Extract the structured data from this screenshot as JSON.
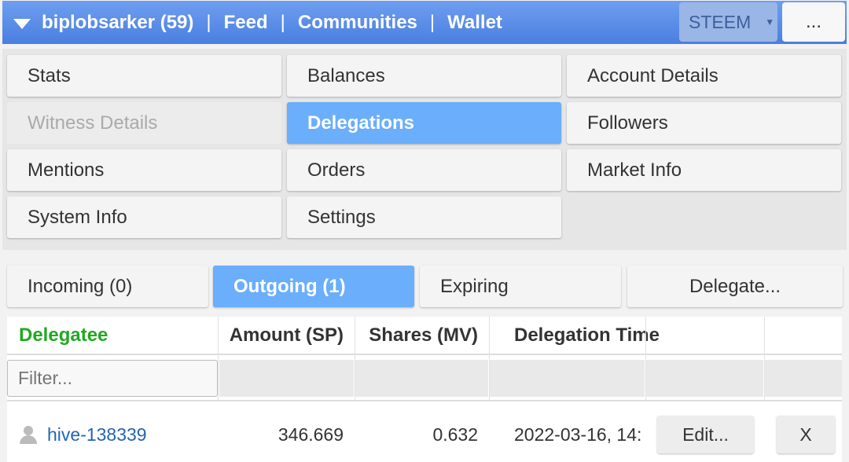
{
  "topbar": {
    "account": "biplobsarker (59)",
    "links": [
      "Feed",
      "Communities",
      "Wallet"
    ],
    "chain": "STEEM",
    "more": "..."
  },
  "menu": {
    "items": [
      {
        "label": "Stats"
      },
      {
        "label": "Balances"
      },
      {
        "label": "Account Details"
      },
      {
        "label": "Witness Details"
      },
      {
        "label": "Delegations"
      },
      {
        "label": "Followers"
      },
      {
        "label": "Mentions"
      },
      {
        "label": "Orders"
      },
      {
        "label": "Market Info"
      },
      {
        "label": "System Info"
      },
      {
        "label": "Settings"
      }
    ]
  },
  "tabs": {
    "incoming": "Incoming (0)",
    "outgoing": "Outgoing (1)",
    "expiring": "Expiring",
    "delegate": "Delegate..."
  },
  "table": {
    "headers": [
      "Delegatee",
      "Amount (SP)",
      "Shares (MV)",
      "Delegation Time"
    ],
    "filter_placeholder": "Filter...",
    "rows": [
      {
        "delegatee": "hive-138339",
        "amount": "346.669",
        "shares": "0.632",
        "time": "2022-03-16, 14:",
        "edit": "Edit...",
        "remove": "X"
      }
    ]
  },
  "colors": {
    "topbar": "#4a7fe0",
    "active": "#6aaefc",
    "delegatee_header": "#22a822",
    "link": "#2464b4"
  }
}
